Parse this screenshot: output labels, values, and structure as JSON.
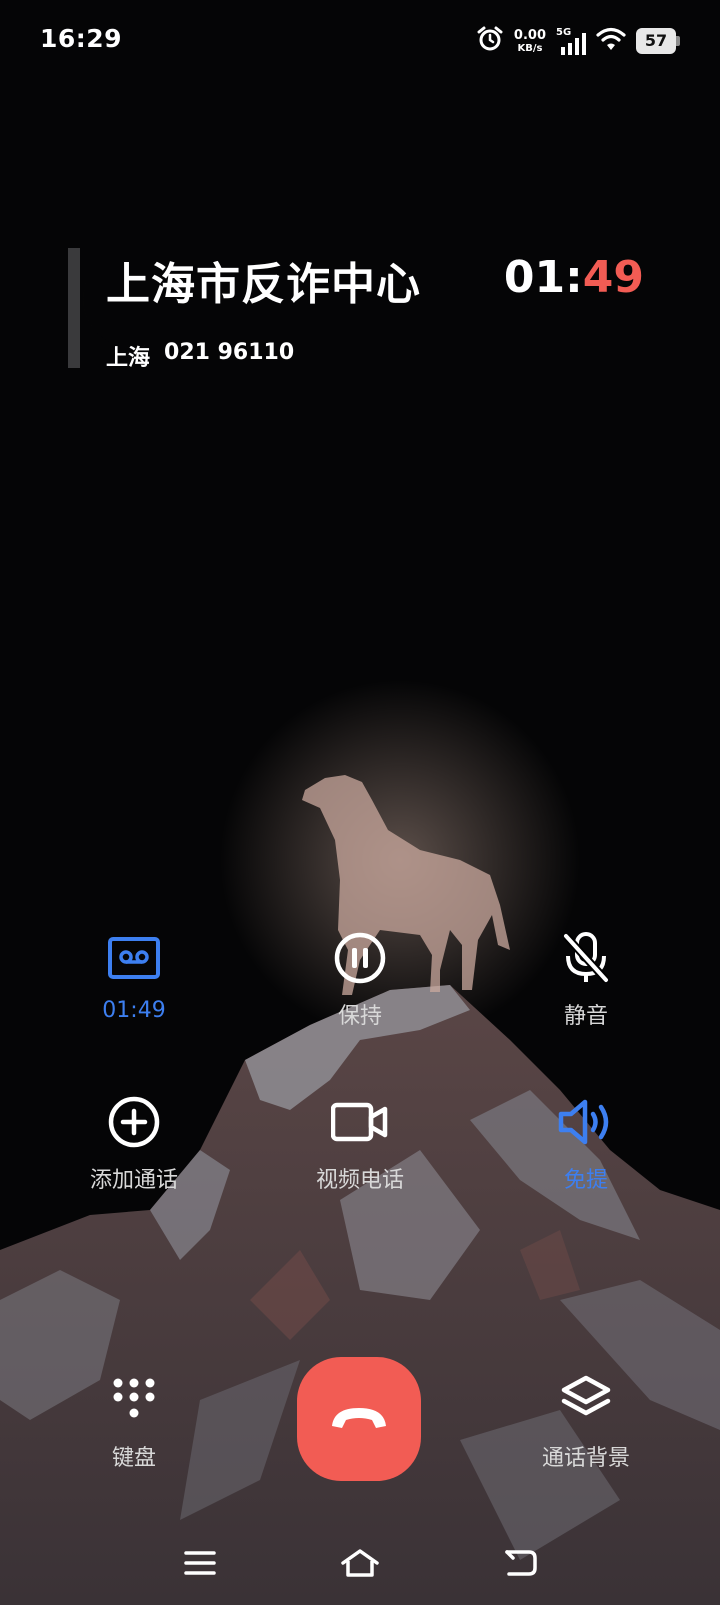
{
  "status_bar": {
    "time": "16:29",
    "net_speed_value": "0.00",
    "net_speed_unit": "KB/s",
    "network_type": "5G",
    "battery_level": "57",
    "icons": [
      "alarm-icon",
      "signal-icon",
      "wifi-icon",
      "battery-icon"
    ]
  },
  "call": {
    "caller_name": "上海市反诈中心",
    "timer_minutes": "01",
    "timer_separator": ":",
    "timer_seconds": "49",
    "location": "上海",
    "number": "021 96110"
  },
  "controls": {
    "record": {
      "label": "01:49",
      "icon": "record-icon",
      "active": true
    },
    "hold": {
      "label": "保持",
      "icon": "pause-icon",
      "active": false
    },
    "mute": {
      "label": "静音",
      "icon": "mic-off-icon",
      "active": false
    },
    "add_call": {
      "label": "添加通话",
      "icon": "add-icon",
      "active": false
    },
    "video_call": {
      "label": "视频电话",
      "icon": "video-icon",
      "active": false
    },
    "speaker": {
      "label": "免提",
      "icon": "speaker-icon",
      "active": true
    },
    "keypad": {
      "label": "键盘",
      "icon": "keypad-icon",
      "active": false
    },
    "call_background": {
      "label": "通话背景",
      "icon": "layers-icon",
      "active": false
    }
  },
  "end_call": {
    "icon": "hang-up-icon"
  },
  "nav_bar": {
    "icons": [
      "menu-icon",
      "home-icon",
      "back-icon"
    ]
  },
  "colors": {
    "accent": "#3d7ff0",
    "end_call": "#f25c54",
    "timer_seconds": "#f25c54",
    "background": "#000000"
  }
}
